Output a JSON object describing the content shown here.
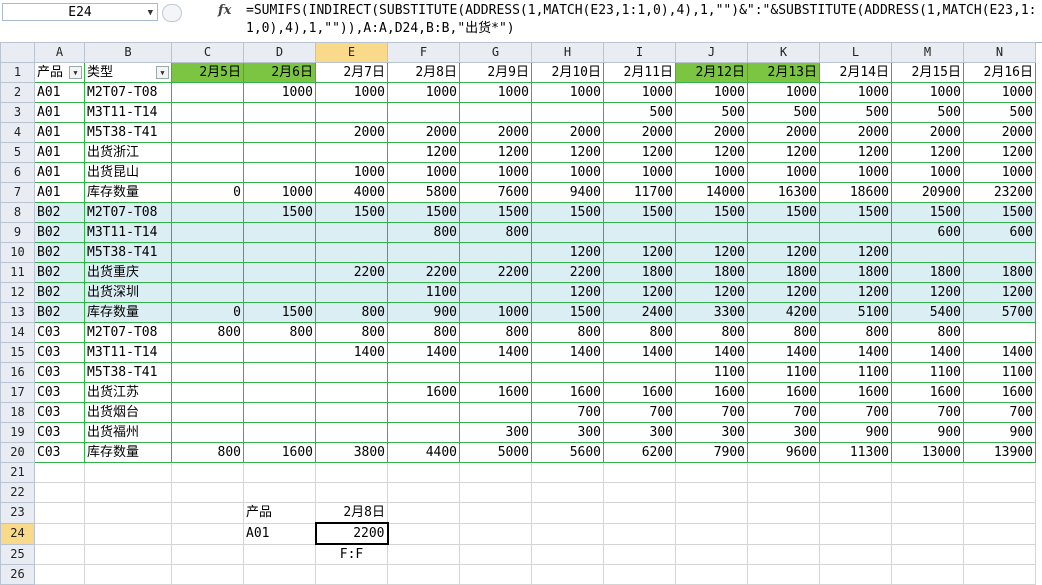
{
  "formula_bar": {
    "name_box": "E24",
    "fx": "fx",
    "formula": "=SUMIFS(INDIRECT(SUBSTITUTE(ADDRESS(1,MATCH(E23,1:1,0),4),1,\"\")&\":\"&SUBSTITUTE(ADDRESS(1,MATCH(E23,1:1,0),4),1,\"\")),A:A,D24,B:B,\"出货*\")"
  },
  "columns": [
    "A",
    "B",
    "C",
    "D",
    "E",
    "F",
    "G",
    "H",
    "I",
    "J",
    "K",
    "L",
    "M",
    "N"
  ],
  "selected_column": "E",
  "selected_row": 24,
  "header_row": [
    "产品",
    "类型",
    "2月5日",
    "2月6日",
    "2月7日",
    "2月8日",
    "2月9日",
    "2月10日",
    "2月11日",
    "2月12日",
    "2月13日",
    "2月14日",
    "2月15日",
    "2月16日"
  ],
  "green_header_cols": [
    2,
    3,
    9,
    10
  ],
  "rows": [
    {
      "n": 2,
      "hl": false,
      "cells": [
        "A01",
        "M2T07-T08",
        "",
        "1000",
        "1000",
        "1000",
        "1000",
        "1000",
        "1000",
        "1000",
        "1000",
        "1000",
        "1000",
        "1000"
      ]
    },
    {
      "n": 3,
      "hl": false,
      "cells": [
        "A01",
        "M3T11-T14",
        "",
        "",
        "",
        "",
        "",
        "",
        "500",
        "500",
        "500",
        "500",
        "500",
        "500"
      ]
    },
    {
      "n": 4,
      "hl": false,
      "cells": [
        "A01",
        "M5T38-T41",
        "",
        "",
        "2000",
        "2000",
        "2000",
        "2000",
        "2000",
        "2000",
        "2000",
        "2000",
        "2000",
        "2000"
      ]
    },
    {
      "n": 5,
      "hl": false,
      "cells": [
        "A01",
        "出货浙江",
        "",
        "",
        "",
        "1200",
        "1200",
        "1200",
        "1200",
        "1200",
        "1200",
        "1200",
        "1200",
        "1200"
      ]
    },
    {
      "n": 6,
      "hl": false,
      "cells": [
        "A01",
        "出货昆山",
        "",
        "",
        "1000",
        "1000",
        "1000",
        "1000",
        "1000",
        "1000",
        "1000",
        "1000",
        "1000",
        "1000"
      ]
    },
    {
      "n": 7,
      "hl": false,
      "cells": [
        "A01",
        "库存数量",
        "0",
        "1000",
        "4000",
        "5800",
        "7600",
        "9400",
        "11700",
        "14000",
        "16300",
        "18600",
        "20900",
        "23200"
      ]
    },
    {
      "n": 8,
      "hl": true,
      "cells": [
        "B02",
        "M2T07-T08",
        "",
        "1500",
        "1500",
        "1500",
        "1500",
        "1500",
        "1500",
        "1500",
        "1500",
        "1500",
        "1500",
        "1500"
      ]
    },
    {
      "n": 9,
      "hl": true,
      "cells": [
        "B02",
        "M3T11-T14",
        "",
        "",
        "",
        "800",
        "800",
        "",
        "",
        "",
        "",
        "",
        "600",
        "600"
      ]
    },
    {
      "n": 10,
      "hl": true,
      "cells": [
        "B02",
        "M5T38-T41",
        "",
        "",
        "",
        "",
        "",
        "1200",
        "1200",
        "1200",
        "1200",
        "1200",
        "",
        ""
      ]
    },
    {
      "n": 11,
      "hl": true,
      "cells": [
        "B02",
        "出货重庆",
        "",
        "",
        "2200",
        "2200",
        "2200",
        "2200",
        "1800",
        "1800",
        "1800",
        "1800",
        "1800",
        "1800"
      ]
    },
    {
      "n": 12,
      "hl": true,
      "cells": [
        "B02",
        "出货深圳",
        "",
        "",
        "",
        "1100",
        "",
        "1200",
        "1200",
        "1200",
        "1200",
        "1200",
        "1200",
        "1200"
      ]
    },
    {
      "n": 13,
      "hl": true,
      "cells": [
        "B02",
        "库存数量",
        "0",
        "1500",
        "800",
        "900",
        "1000",
        "1500",
        "2400",
        "3300",
        "4200",
        "5100",
        "5400",
        "5700"
      ]
    },
    {
      "n": 14,
      "hl": false,
      "cells": [
        "C03",
        "M2T07-T08",
        "800",
        "800",
        "800",
        "800",
        "800",
        "800",
        "800",
        "800",
        "800",
        "800",
        "800",
        ""
      ]
    },
    {
      "n": 15,
      "hl": false,
      "cells": [
        "C03",
        "M3T11-T14",
        "",
        "",
        "1400",
        "1400",
        "1400",
        "1400",
        "1400",
        "1400",
        "1400",
        "1400",
        "1400",
        "1400"
      ]
    },
    {
      "n": 16,
      "hl": false,
      "cells": [
        "C03",
        "M5T38-T41",
        "",
        "",
        "",
        "",
        "",
        "",
        "",
        "1100",
        "1100",
        "1100",
        "1100",
        "1100"
      ]
    },
    {
      "n": 17,
      "hl": false,
      "cells": [
        "C03",
        "出货江苏",
        "",
        "",
        "",
        "1600",
        "1600",
        "1600",
        "1600",
        "1600",
        "1600",
        "1600",
        "1600",
        "1600"
      ]
    },
    {
      "n": 18,
      "hl": false,
      "cells": [
        "C03",
        "出货烟台",
        "",
        "",
        "",
        "",
        "",
        "700",
        "700",
        "700",
        "700",
        "700",
        "700",
        "700"
      ]
    },
    {
      "n": 19,
      "hl": false,
      "cells": [
        "C03",
        "出货福州",
        "",
        "",
        "",
        "",
        "300",
        "300",
        "300",
        "300",
        "300",
        "900",
        "900",
        "900"
      ]
    },
    {
      "n": 20,
      "hl": false,
      "cells": [
        "C03",
        "库存数量",
        "800",
        "1600",
        "3800",
        "4400",
        "5000",
        "5600",
        "6200",
        "7900",
        "9600",
        "11300",
        "13000",
        "13900"
      ]
    }
  ],
  "extra_rows": [
    {
      "n": 21,
      "cells": {}
    },
    {
      "n": 22,
      "cells": {}
    },
    {
      "n": 23,
      "cells": {
        "3": "产品",
        "4": "2月8日"
      }
    },
    {
      "n": 24,
      "cells": {
        "3": "A01",
        "4": "2200"
      }
    },
    {
      "n": 25,
      "cells": {
        "4": "F:F"
      }
    },
    {
      "n": 26,
      "cells": {}
    }
  ],
  "colors": {
    "green_header": "#7cc542",
    "row_highlight": "#dbeef3",
    "table_border": "#33b34a",
    "selected_header": "#f9d98a"
  }
}
